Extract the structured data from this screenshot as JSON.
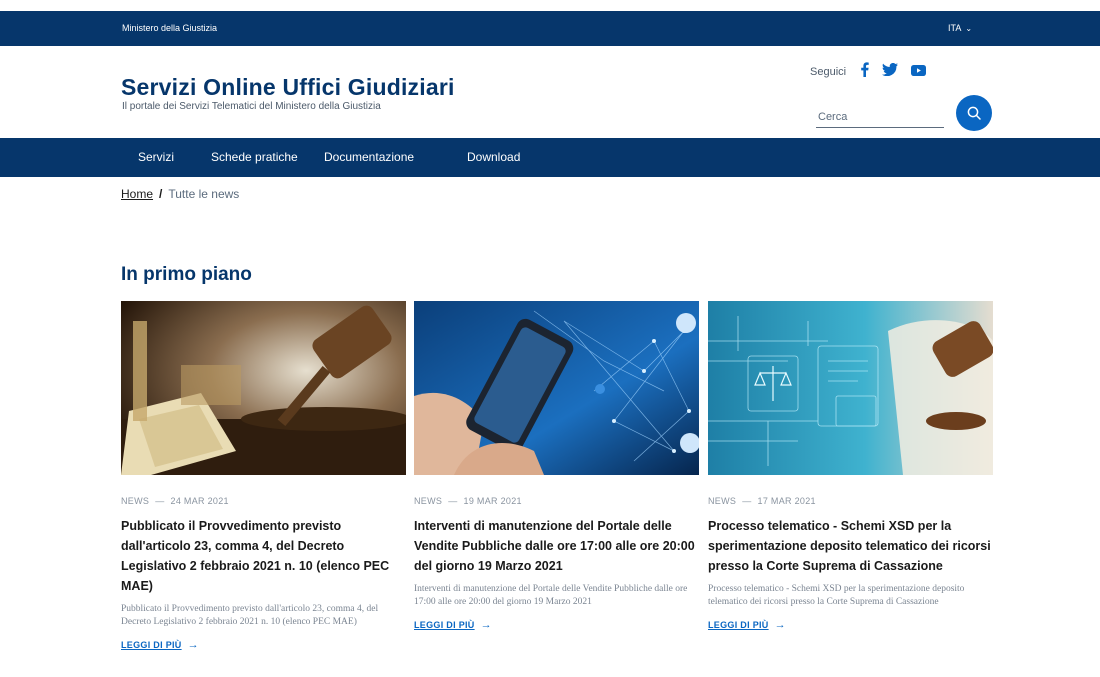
{
  "header": {
    "slim_brand": "Ministero della Giustizia",
    "language": "ITA",
    "site_title": "Servizi Online Uffici Giudiziari",
    "site_subtitle": "Il portale dei Servizi Telematici del Ministero della Giustizia",
    "social_label": "Seguici",
    "social_icons": [
      "facebook-icon",
      "twitter-icon",
      "youtube-icon"
    ],
    "search_placeholder": "Cerca"
  },
  "nav": {
    "items": [
      "Servizi",
      "Schede pratiche",
      "Documentazione",
      "Download"
    ]
  },
  "breadcrumb": {
    "home": "Home",
    "separator": "/",
    "current": "Tutte le news"
  },
  "section": {
    "title": "In primo piano"
  },
  "cards": [
    {
      "category": "NEWS",
      "date": "24 MAR 2021",
      "title": "Pubblicato il Provvedimento previsto dall'articolo 23, comma 4, del Decreto Legislativo 2 febbraio 2021 n. 10 (elenco PEC MAE)",
      "text": "Pubblicato il Provvedimento previsto dall'articolo 23, comma 4, del Decreto Legislativo 2 febbraio 2021 n. 10 (elenco PEC MAE)",
      "more": "LEGGI DI PIÙ"
    },
    {
      "category": "NEWS",
      "date": "19 MAR 2021",
      "title": "Interventi di manutenzione del Portale delle Vendite Pubbliche dalle ore 17:00 alle ore 20:00 del giorno 19 Marzo 2021",
      "text": "Interventi di manutenzione del Portale delle Vendite Pubbliche dalle ore 17:00 alle ore 20:00 del giorno 19 Marzo 2021",
      "more": "LEGGI DI PIÙ"
    },
    {
      "category": "NEWS",
      "date": "17 MAR 2021",
      "title": "Processo telematico - Schemi XSD per la sperimentazione deposito telematico dei ricorsi presso la Corte Suprema di Cassazione",
      "text": "Processo telematico - Schemi XSD per la sperimentazione deposito telematico dei ricorsi presso la Corte Suprema di Cassazione",
      "more": "LEGGI DI PIÙ"
    }
  ],
  "colors": {
    "primary_dark": "#06366b",
    "accent_blue": "#0a66c2",
    "muted_text": "#7b8592"
  }
}
